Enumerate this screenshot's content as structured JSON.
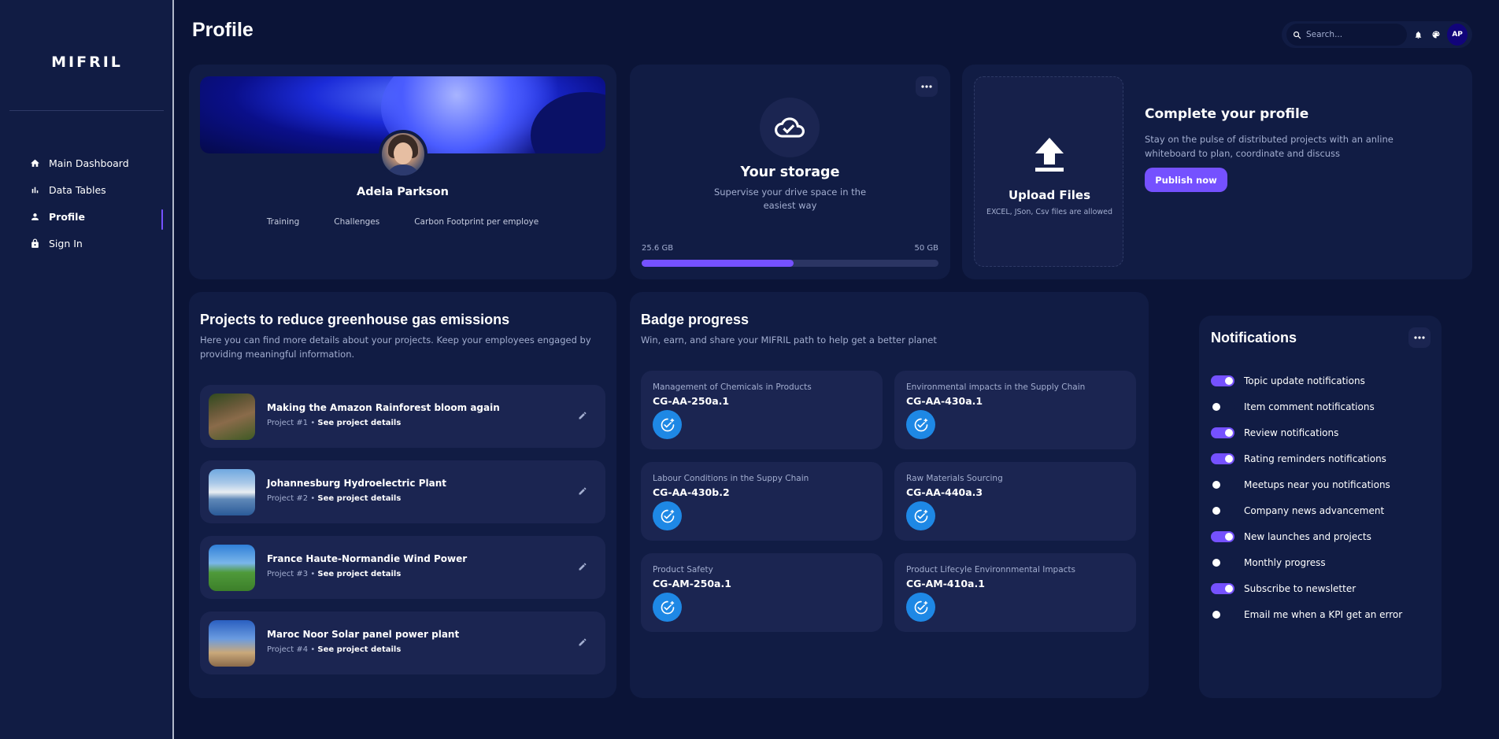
{
  "sidebar": {
    "logo": "MIFRIL",
    "items": [
      {
        "label": "Main Dashboard",
        "icon": "home-icon"
      },
      {
        "label": "Data Tables",
        "icon": "bar-chart-icon"
      },
      {
        "label": "Profile",
        "icon": "person-icon",
        "active": true
      },
      {
        "label": "Sign In",
        "icon": "lock-icon"
      }
    ]
  },
  "header": {
    "title": "Profile",
    "search_placeholder": "Search...",
    "avatar_initials": "AP"
  },
  "profile": {
    "name": "Adela Parkson",
    "stats": [
      "Training",
      "Challenges",
      "Carbon Footprint per employe"
    ]
  },
  "storage": {
    "title": "Your storage",
    "subtitle": "Supervise your drive space in the easiest way",
    "used": "25.6 GB",
    "total": "50 GB",
    "used_fraction": 0.512
  },
  "upload": {
    "title": "Upload Files",
    "subtitle": "EXCEL, JSon, Csv files are allowed",
    "complete_title": "Complete your profile",
    "complete_desc": "Stay on the pulse of distributed projects with an anline whiteboard to plan, coordinate and discuss",
    "publish_label": "Publish now"
  },
  "projects": {
    "title": "Projects to reduce greenhouse gas emissions",
    "description": "Here you can find more details about your projects. Keep your employees engaged by providing meaningful information.",
    "link_label": "See project details",
    "items": [
      {
        "title": "Making the Amazon Rainforest bloom again",
        "number": "Project #1 •"
      },
      {
        "title": "Johannesburg Hydroelectric Plant",
        "number": "Project #2 •"
      },
      {
        "title": "France Haute-Normandie Wind Power",
        "number": "Project #3 •"
      },
      {
        "title": "Maroc Noor Solar panel power plant",
        "number": "Project #4 •"
      }
    ]
  },
  "badges": {
    "title": "Badge progress",
    "description": "Win, earn, and share your MIFRIL path to help get a better planet",
    "items": [
      {
        "name": "Management of Chemicals in Products",
        "code": "CG-AA-250a.1"
      },
      {
        "name": "Environmental impacts in the Supply Chain",
        "code": "CG-AA-430a.1"
      },
      {
        "name": "Labour Conditions in the Suppy Chain",
        "code": "CG-AA-430b.2"
      },
      {
        "name": "Raw Materials Sourcing",
        "code": "CG-AA-440a.3"
      },
      {
        "name": "Product Safety",
        "code": "CG-AM-250a.1"
      },
      {
        "name": "Product Lifecyle Environnmental Impacts",
        "code": "CG-AM-410a.1"
      }
    ]
  },
  "notifications": {
    "title": "Notifications",
    "items": [
      {
        "label": "Topic update notifications",
        "on": true
      },
      {
        "label": "Item comment notifications",
        "on": false
      },
      {
        "label": "Review notifications",
        "on": true
      },
      {
        "label": "Rating reminders notifications",
        "on": true
      },
      {
        "label": "Meetups near you notifications",
        "on": false
      },
      {
        "label": "Company news advancement",
        "on": false
      },
      {
        "label": "New launches and projects",
        "on": true
      },
      {
        "label": "Monthly progress",
        "on": false
      },
      {
        "label": "Subscribe to newsletter",
        "on": true
      },
      {
        "label": "Email me when a KPI get an error",
        "on": false
      }
    ]
  },
  "colors": {
    "background": "#0b1437",
    "card": "#111c44",
    "accent": "#7551ff",
    "badge_icon": "#1e88e5"
  }
}
